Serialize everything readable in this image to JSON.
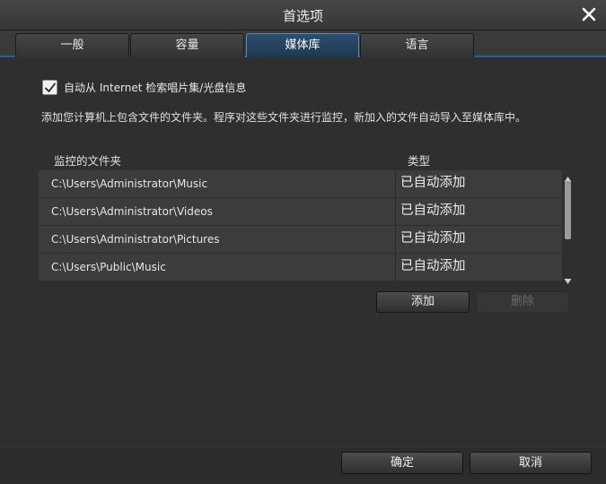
{
  "window": {
    "title": "首选项",
    "close_icon": "close-icon"
  },
  "tabs": [
    {
      "label": "一般",
      "active": false
    },
    {
      "label": "容量",
      "active": false
    },
    {
      "label": "媒体库",
      "active": true
    },
    {
      "label": "语言",
      "active": false
    }
  ],
  "media_library": {
    "auto_fetch": {
      "checked": true,
      "label": "自动从 Internet 检索唱片集/光盘信息"
    },
    "description": "添加您计算机上包含文件的文件夹。程序对这些文件夹进行监控，新加入的文件自动导入至媒体库中。",
    "columns": {
      "folder": "监控的文件夹",
      "type": "类型"
    },
    "rows": [
      {
        "path": "C:\\Users\\Administrator\\Music",
        "type": "已自动添加"
      },
      {
        "path": "C:\\Users\\Administrator\\Videos",
        "type": "已自动添加"
      },
      {
        "path": "C:\\Users\\Administrator\\Pictures",
        "type": "已自动添加"
      },
      {
        "path": "C:\\Users\\Public\\Music",
        "type": "已自动添加"
      }
    ],
    "add_label": "添加",
    "delete_label": "删除"
  },
  "footer": {
    "ok_label": "确定",
    "cancel_label": "取消"
  },
  "colors": {
    "accent": "#2c5f8c",
    "active_tab": "#1f3850",
    "background": "#2f2f2f"
  }
}
